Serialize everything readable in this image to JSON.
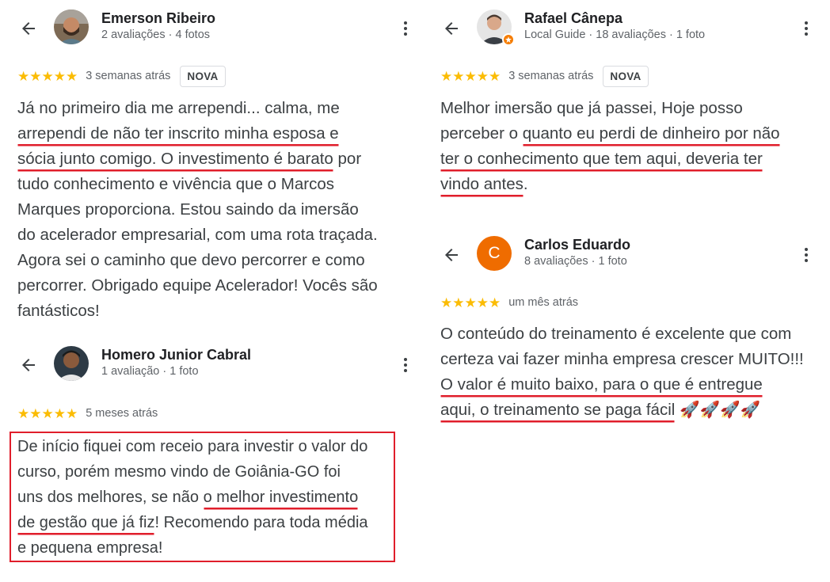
{
  "reviews": [
    {
      "name": "Emerson Ribeiro",
      "meta": "2 avaliações · 4 fotos",
      "stars": "★★★★★",
      "when": "3 semanas atrás",
      "badge": "NOVA",
      "lines": [
        [
          "Já no primeiro dia me arrependi... calma, me"
        ],
        [
          "",
          "arrependi de não ter inscrito minha esposa e "
        ],
        [
          "",
          "sócia junto comigo. O investimento é barato",
          " por"
        ],
        [
          "tudo conhecimento e vivência que o Marcos"
        ],
        [
          "Marques proporciona. Estou saindo da imersão"
        ],
        [
          "do acelerador empresarial, com uma rota traçada."
        ],
        [
          "Agora sei o caminho que devo percorrer e como"
        ],
        [
          "percorrer. Obrigado equipe Acelerador! Vocês são"
        ],
        [
          "fantásticos!"
        ]
      ]
    },
    {
      "name": "Homero Junior Cabral",
      "meta": "1 avaliação · 1 foto",
      "stars": "★★★★★",
      "when": "5 meses atrás",
      "lines": [
        [
          "De início fiquei com receio para investir o valor do"
        ],
        [
          "curso, porém mesmo vindo de Goiânia-GO foi"
        ],
        [
          "uns dos melhores, se não ",
          "o melhor investimento"
        ],
        [
          "",
          "de gestão que já fiz",
          "! Recomendo para toda média"
        ],
        [
          "e pequena empresa!"
        ]
      ]
    },
    {
      "name": "Rafael Cânepa",
      "meta": "Local Guide · 18 avaliações · 1 foto",
      "stars": "★★★★★",
      "when": "3 semanas atrás",
      "badge": "NOVA",
      "lines": [
        [
          "Melhor imersão que já passei, Hoje posso"
        ],
        [
          "perceber o ",
          "quanto eu perdi de dinheiro por não"
        ],
        [
          "",
          "ter o conhecimento que tem aqui, deveria ter"
        ],
        [
          "",
          "vindo antes",
          "."
        ]
      ]
    },
    {
      "name": "Carlos Eduardo",
      "avatar_letter": "C",
      "meta": "8 avaliações · 1 foto",
      "stars": "★★★★★",
      "when": "um mês atrás",
      "lines": [
        [
          "O conteúdo do treinamento é excelente que com"
        ],
        [
          "certeza vai fazer minha empresa crescer MUITO!!!"
        ],
        [
          "",
          "O valor é muito baixo, para o que é entregue"
        ],
        [
          "",
          "aqui, o treinamento se paga fácil",
          " 🚀🚀🚀🚀"
        ]
      ]
    }
  ],
  "colors": {
    "star": "#fbbc04",
    "highlight": "#e01e2b",
    "avatar_c": "#ef6c00"
  }
}
